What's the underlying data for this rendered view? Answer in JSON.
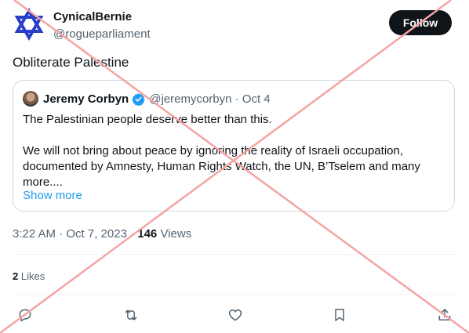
{
  "post": {
    "display_name": "CynicalBernie",
    "handle": "@rogueparliament",
    "follow_label": "Follow",
    "text": "Obliterate Palestine",
    "timestamp": "3:22 AM · Oct 7, 2023 ·",
    "views_count": "146",
    "views_label": "Views",
    "likes_count": "2",
    "likes_label": "Likes",
    "avatar_icon": "star-of-david-icon",
    "avatar_color": "#2a3fc9"
  },
  "quote": {
    "name": "Jeremy Corbyn",
    "handle": "@jeremycorbyn · Oct 4",
    "verified_color": "#1d9bf0",
    "para1": "The Palestinian people deserve better than this.",
    "para2": "We will not bring about peace by ignoring the reality of Israeli occupation, documented by Amnesty, Human Rights Watch, the UN, B’Tselem and many more....",
    "show_more": "Show more"
  },
  "actions": [
    "reply-icon",
    "repost-icon",
    "like-icon",
    "bookmark-icon",
    "share-icon"
  ],
  "overlay_color": "#f5a3a3"
}
